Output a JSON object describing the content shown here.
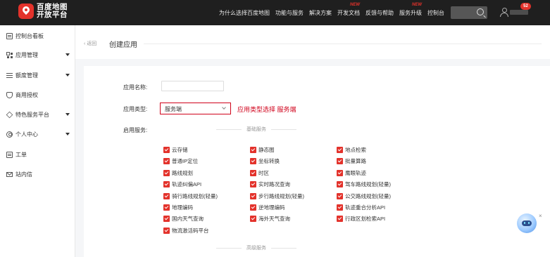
{
  "topbar": {
    "logo_line1": "百度地图",
    "logo_line2": "开放平台",
    "nav": [
      {
        "label": "为什么选择百度地图",
        "badge": ""
      },
      {
        "label": "功能与服务",
        "badge": ""
      },
      {
        "label": "解决方案",
        "badge": ""
      },
      {
        "label": "开发文档",
        "badge": "NEW"
      },
      {
        "label": "反馈与帮助",
        "badge": ""
      },
      {
        "label": "服务升级",
        "badge": "NEW"
      },
      {
        "label": "控制台",
        "badge": ""
      }
    ],
    "notification_count": "52"
  },
  "sidebar": {
    "items": [
      {
        "label": "控制台看板",
        "icon": "dashboard-icon"
      },
      {
        "label": "应用管理",
        "icon": "grid-icon"
      },
      {
        "label": "额度管理",
        "icon": "quota-icon"
      },
      {
        "label": "商用授权",
        "icon": "shield-icon"
      },
      {
        "label": "特色服务平台",
        "icon": "heart-icon"
      },
      {
        "label": "个人中心",
        "icon": "person-icon"
      },
      {
        "label": "工单",
        "icon": "ticket-icon"
      },
      {
        "label": "站内信",
        "icon": "mail-icon"
      }
    ]
  },
  "header": {
    "back_label": "返回",
    "title": "创建应用"
  },
  "form": {
    "name_label": "应用名称:",
    "name_value": "",
    "type_label": "应用类型:",
    "type_value": "服务端",
    "annotation": "应用类型选择 服务端",
    "services_label": "启用服务:",
    "basic_title": "基础服务",
    "advanced_title": "高级服务",
    "services": [
      [
        "云存储",
        "静态图",
        "地点检索"
      ],
      [
        "普通IP定位",
        "坐标转换",
        "批量算路"
      ],
      [
        "路线规划",
        "时区",
        "鹰眼轨迹"
      ],
      [
        "轨迹纠偏API",
        "实时路况查询",
        "驾车路线规划(轻量)"
      ],
      [
        "骑行路线规划(轻量)",
        "步行路线规划(轻量)",
        "公交路线规划(轻量)"
      ],
      [
        "地理编码",
        "逆地理编码",
        "轨迹重合分析API"
      ],
      [
        "国内天气查询",
        "海外天气查询",
        "行政区划检索API"
      ],
      [
        "物流激活码平台"
      ]
    ]
  },
  "bot": {
    "close_label": "×"
  },
  "colors": {
    "accent": "#e3322b",
    "topbar": "#1f1f1f",
    "highlight": "#d0021b"
  }
}
